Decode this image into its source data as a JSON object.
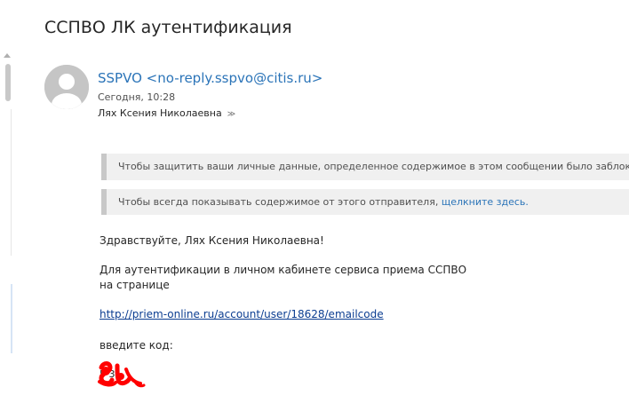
{
  "email": {
    "subject": "ССПВО ЛК аутентификация",
    "sender": "SSPVO <no-reply.sspvo@citis.ru>",
    "date": "Сегодня, 10:28",
    "recipient": "Лях Ксения Николаевна",
    "expand_glyph": "≫"
  },
  "banners": {
    "blocked_text": "Чтобы защитить ваши личные данные, определенное содержимое в этом сообщении было заблокиров",
    "show_text": "Чтобы всегда показывать содержимое от этого отправителя,",
    "show_link": "щелкните здесь."
  },
  "body": {
    "greeting": "Здравствуйте, Лях Ксения Николаевна!",
    "para_line1": "Для аутентификации в личном кабинете сервиса приема ССПВО",
    "para_line2": "на странице",
    "link": "http://priem-online.ru/account/user/18628/emailcode",
    "code_label": "введите код:",
    "code_value": "5 3"
  },
  "colors": {
    "link": "#2b74b8",
    "redaction": "#ff0000",
    "banner_bg": "#f0f0f0"
  }
}
